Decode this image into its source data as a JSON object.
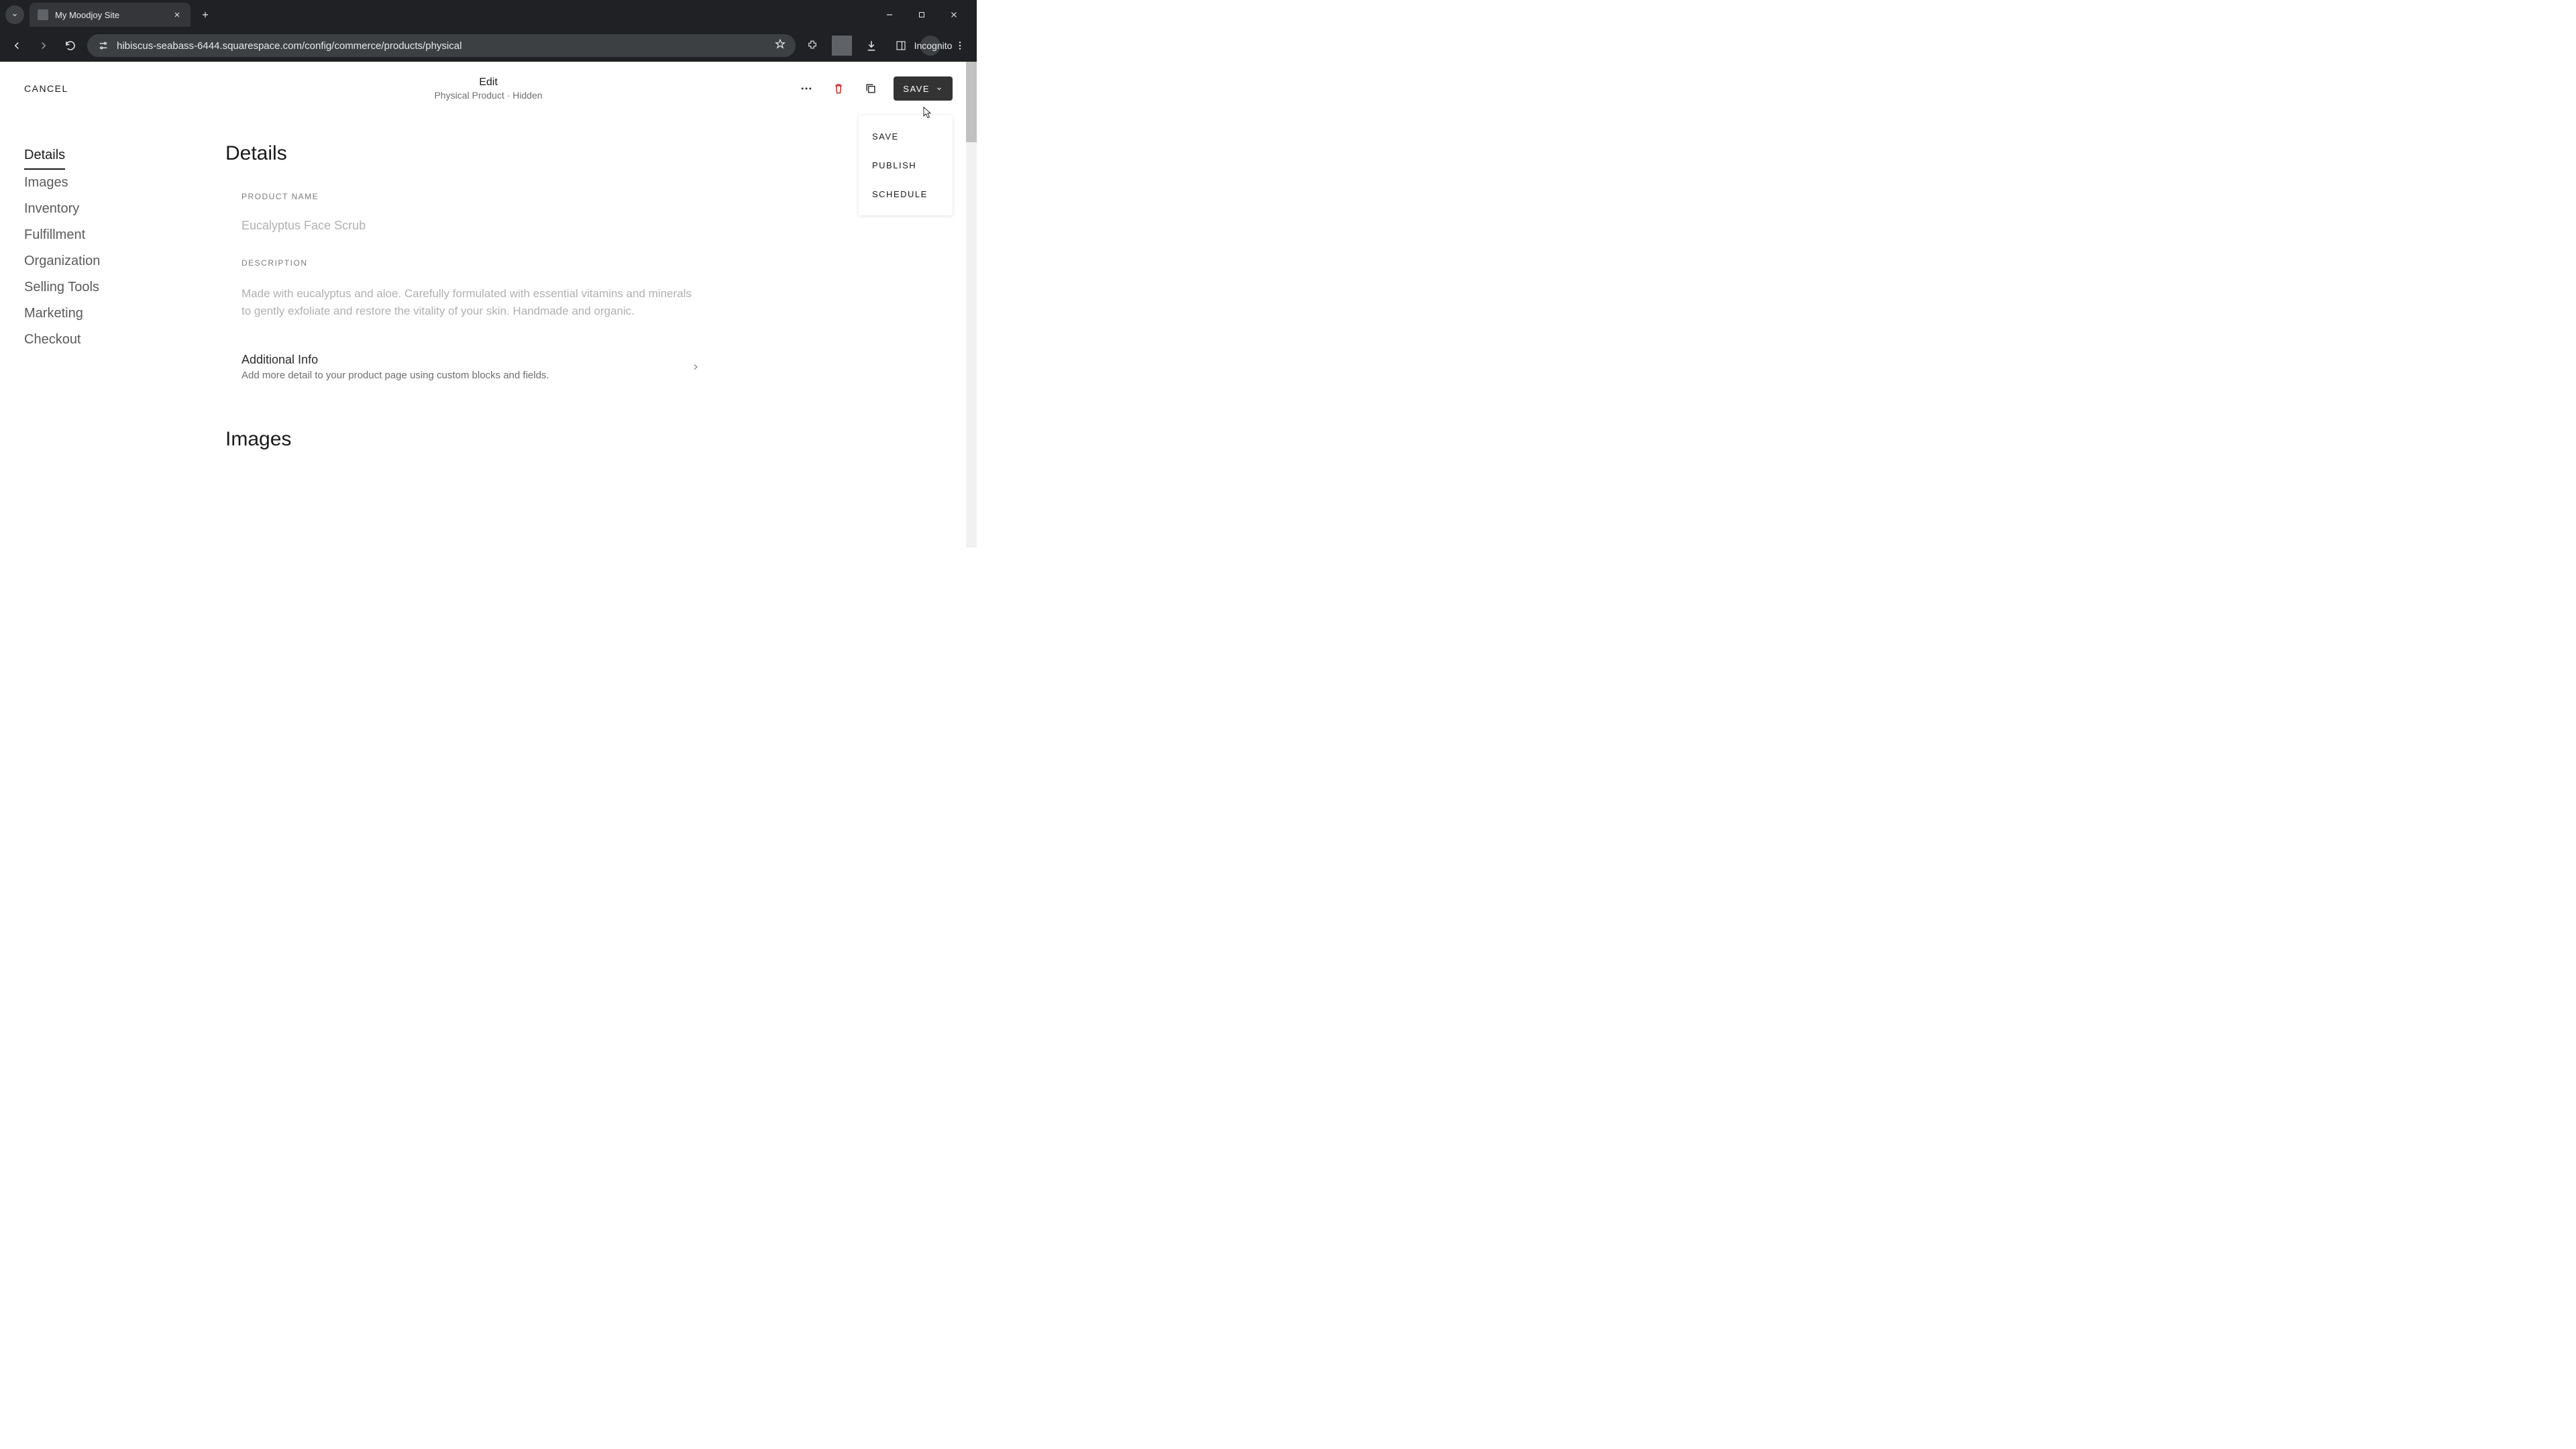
{
  "browser": {
    "tab_title": "My Moodjoy Site",
    "url": "hibiscus-seabass-6444.squarespace.com/config/commerce/products/physical",
    "incognito_label": "Incognito"
  },
  "header": {
    "cancel": "CANCEL",
    "title": "Edit",
    "subtitle": "Physical Product · Hidden",
    "save_label": "SAVE",
    "dropdown": {
      "save": "SAVE",
      "publish": "PUBLISH",
      "schedule": "SCHEDULE"
    }
  },
  "sidebar": {
    "items": [
      "Details",
      "Images",
      "Inventory",
      "Fulfillment",
      "Organization",
      "Selling Tools",
      "Marketing",
      "Checkout"
    ]
  },
  "details": {
    "heading": "Details",
    "product_name_label": "PRODUCT NAME",
    "product_name_value": "Eucalyptus Face Scrub",
    "description_label": "DESCRIPTION",
    "description_value": "Made with eucalyptus and aloe. Carefully formulated with essential vitamins and minerals to gently exfoliate and restore the vitality of your skin. Handmade and organic.",
    "additional_info_title": "Additional Info",
    "additional_info_sub": "Add more detail to your product page using custom blocks and fields."
  },
  "images": {
    "heading": "Images"
  }
}
